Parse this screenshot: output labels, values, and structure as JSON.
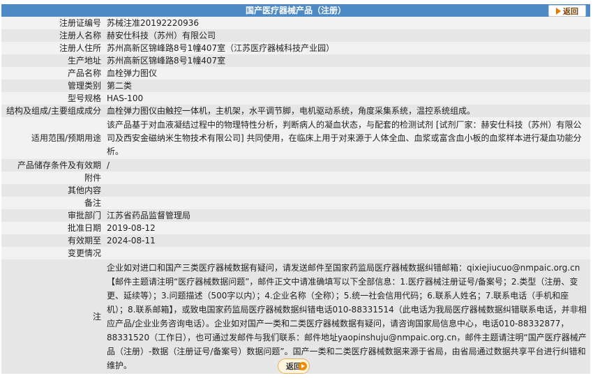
{
  "header": {
    "title": "国产医疗器械产品（注册）",
    "back_label": "返回"
  },
  "rows": [
    {
      "label": "注册证编号",
      "value": "苏械注准20192220936"
    },
    {
      "label": "注册人名称",
      "value": "赫安仕科技（苏州）有限公司"
    },
    {
      "label": "注册人住所",
      "value": "苏州高新区锦峰路8号1幢407室（江苏医疗器械科技产业园）"
    },
    {
      "label": "生产地址",
      "value": "苏州高新区锦峰路8号1幢407室"
    },
    {
      "label": "产品名称",
      "value": "血栓弹力图仪"
    },
    {
      "label": "管理类别",
      "value": "第二类"
    },
    {
      "label": "型号规格",
      "value": "HAS-100"
    },
    {
      "label": "结构及组成/主要组成成分",
      "value": "血栓弹力图仪由触控一体机，主机架，水平调节脚，电机驱动系统，角度采集系统，温控系统组成。"
    },
    {
      "label": "适用范围/预期用途",
      "value": "该产品基于对血液凝结过程中的物理特性分析，判断病人的凝血状态，与配套的检测试剂 [试剂厂家：赫安仕科技（苏州）有限公司及西安金磁纳米生物技术有限公司] 共同使用，在临床上用于对来源于人体全血、血浆或富含血小板的血浆样本进行凝血功能分析。"
    },
    {
      "label": "产品储存条件及有效期",
      "value": "/"
    },
    {
      "label": "附件",
      "value": ""
    },
    {
      "label": "其他内容",
      "value": ""
    },
    {
      "label": "备注",
      "value": ""
    },
    {
      "label": "审批部门",
      "value": "江苏省药品监督管理局"
    },
    {
      "label": "批准日期",
      "value": "2019-08-12"
    },
    {
      "label": "有效期至",
      "value": "2024-08-11"
    },
    {
      "label": "变更情况",
      "value": ""
    },
    {
      "label": "注",
      "value": "企业如对进口和国产三类医疗器械数据有疑问，请发送邮件至国家药监局医疗器械数据纠错邮箱：qixiejiucuo@nmpaic.org.cn【邮件主题请注明“医疗器械数据问题”，邮件正文中请准确填写以下全部信息：1.医疗器械注册证号/备案号；2.类型（注册、变更、延续等）；3.问题描述（500字以内）；4.企业名称（全称）；5.统一社会信用代码；6.联系人姓名；7.联系电话（手机和座机）；8.联系邮箱】，或致电国家药监局医疗器械数据纠错电话010-88331514（此电话为我局医疗器械数据纠错联系电话，并非相应产品/企业业务咨询电话）。企业如对国产一类和二类医疗器械数据有疑问，请咨询国家局信息中心，电话010-88332877，88331520（工作日），也可通过发邮件与我们联系：邮件地址yaopinshuju@nmpaic.org.cn，邮件主题请注明“国产医疗器械产品（注册）-数据（注册证号/备案号）数据问题”。国产一类和二类医疗器械数据来源于省局，由省局通过数据共享平台进行纠错和维护。"
    }
  ],
  "footer": {
    "back_label": "返回"
  },
  "colors": {
    "header_bg": "#4d8ac6",
    "row_light": "#f2f2f2",
    "row_dark": "#e6e6e6",
    "accent_orange": "#f08a00"
  }
}
